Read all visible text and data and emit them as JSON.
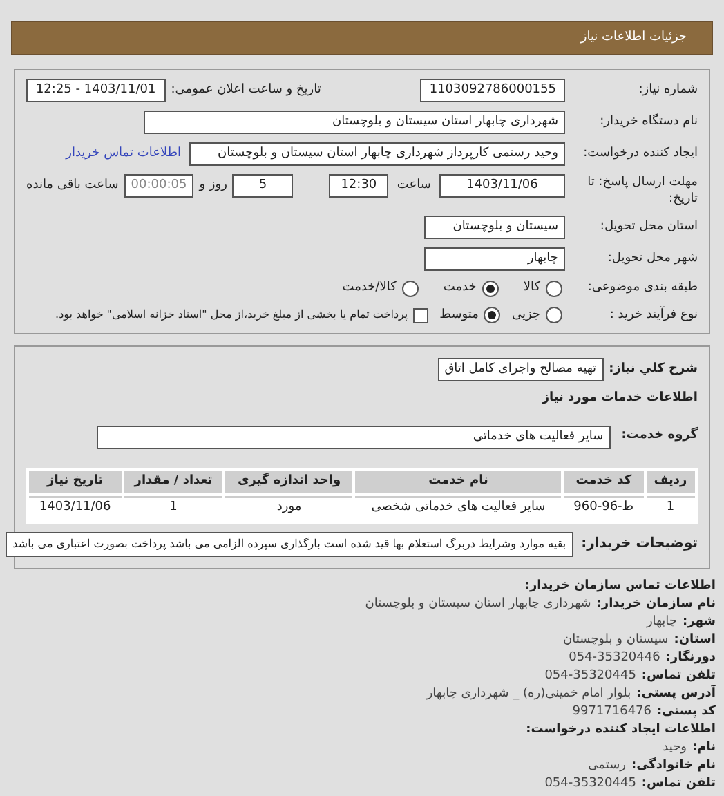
{
  "header": {
    "title": "جزئیات اطلاعات نیاز"
  },
  "need": {
    "number_label": "شماره نیاز:",
    "number": "1103092786000155",
    "announce_label": "تاریخ و ساعت اعلان عمومی:",
    "announce": "1403/11/01 - 12:25",
    "buyer_label": "نام دستگاه خریدار:",
    "buyer": "شهرداری چابهار استان سیستان و بلوچستان",
    "creator_label": "ایجاد کننده درخواست:",
    "creator": "وحید رستمی کارپرداز شهرداری چابهار استان سیستان و بلوچستان",
    "contact_link": "اطلاعات تماس خریدار",
    "deadline_label": "مهلت ارسال پاسخ: تا تاریخ:",
    "deadline_date": "1403/11/06",
    "time_label": "ساعت",
    "deadline_time": "12:30",
    "days": "5",
    "days_label": "روز و",
    "remaining": "00:00:05",
    "remaining_label": "ساعت باقی مانده",
    "province_label": "استان محل تحویل:",
    "province": "سیستان و بلوچستان",
    "city_label": "شهر محل تحویل:",
    "city": "چابهار",
    "category_label": "طبقه بندی موضوعی:",
    "category_options": [
      {
        "label": "کالا",
        "selected": false
      },
      {
        "label": "خدمت",
        "selected": true
      },
      {
        "label": "کالا/خدمت",
        "selected": false
      }
    ],
    "process_label": "نوع فرآیند خرید :",
    "process_options": [
      {
        "label": "جزیی",
        "selected": false
      },
      {
        "label": "متوسط",
        "selected": true
      }
    ],
    "treasury": {
      "label": "پرداخت تمام یا بخشی از مبلغ خرید،از محل \"اسناد خزانه اسلامی\" خواهد بود.",
      "checked": false
    }
  },
  "details": {
    "summary_label": "شرح کلي نیاز:",
    "summary": "تهیه مصالح واجرای کامل اتاق",
    "services_title": "اطلاعات خدمات مورد نیاز",
    "group_label": "گروه خدمت:",
    "group": "سایر فعالیت های خدماتی",
    "table": {
      "columns": [
        "ردیف",
        "کد خدمت",
        "نام خدمت",
        "واحد اندازه گیری",
        "تعداد / مقدار",
        "تاریخ نیاز"
      ],
      "rows": [
        [
          "1",
          "ط-96-960",
          "سایر فعالیت های خدماتی شخصی",
          "مورد",
          "1",
          "1403/11/06"
        ]
      ]
    },
    "notes_label": "توضیحات خریدار:",
    "notes": "بقیه موارد وشرایط دربرگ استعلام بها قید شده است بارگذاری سپرده الزامی می باشد پرداخت بصورت اعتباری می باشد"
  },
  "contact": {
    "lines": [
      {
        "kind": "heading",
        "label": "اطلاعات تماس سازمان خریدار:"
      },
      {
        "kind": "pair",
        "label": "نام سازمان خریدار:",
        "value": "شهرداری چابهار استان سیستان و بلوچستان"
      },
      {
        "kind": "pair",
        "label": "شهر:",
        "value": "چابهار"
      },
      {
        "kind": "pair",
        "label": "استان:",
        "value": "سیستان و بلوچستان"
      },
      {
        "kind": "pair",
        "label": "دورنگار:",
        "value": "054-35320446"
      },
      {
        "kind": "pair",
        "label": "تلفن تماس:",
        "value": "054-35320445"
      },
      {
        "kind": "pair",
        "label": "آدرس پستی:",
        "value": "بلوار امام خمینی(ره) _ شهرداری چابهار"
      },
      {
        "kind": "pair",
        "label": "کد پستی:",
        "value": "9971716476"
      },
      {
        "kind": "heading",
        "label": "اطلاعات ایجاد کننده درخواست:"
      },
      {
        "kind": "pair",
        "label": "نام:",
        "value": "وحید"
      },
      {
        "kind": "pair",
        "label": "نام خانوادگی:",
        "value": "رستمی"
      },
      {
        "kind": "pair",
        "label": "تلفن تماس:",
        "value": "054-35320445"
      }
    ]
  }
}
